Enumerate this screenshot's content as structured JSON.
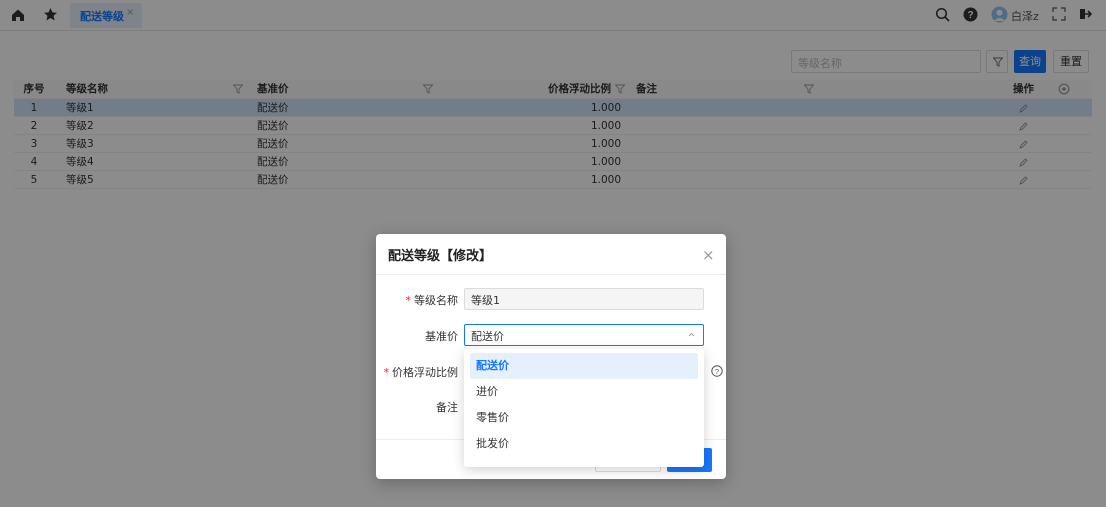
{
  "topbar": {
    "tab_label": "配送等级",
    "tab_close": "×",
    "user_name": "白泽z"
  },
  "toolbar": {
    "search_placeholder": "等级名称",
    "query_label": "查询",
    "reset_label": "重置"
  },
  "grid": {
    "headers": {
      "idx": "序号",
      "name": "等级名称",
      "base": "基准价",
      "rate": "价格浮动比例",
      "note": "备注",
      "op": "操作"
    },
    "rows": [
      {
        "idx": "1",
        "name": "等级1",
        "base": "配送价",
        "rate": "1.000",
        "note": ""
      },
      {
        "idx": "2",
        "name": "等级2",
        "base": "配送价",
        "rate": "1.000",
        "note": ""
      },
      {
        "idx": "3",
        "name": "等级3",
        "base": "配送价",
        "rate": "1.000",
        "note": ""
      },
      {
        "idx": "4",
        "name": "等级4",
        "base": "配送价",
        "rate": "1.000",
        "note": ""
      },
      {
        "idx": "5",
        "name": "等级5",
        "base": "配送价",
        "rate": "1.000",
        "note": ""
      }
    ]
  },
  "modal": {
    "title": "配送等级【修改】",
    "close": "×",
    "fields": {
      "name_label": "等级名称",
      "name_value": "等级1",
      "base_label": "基准价",
      "base_value": "配送价",
      "rate_label": "价格浮动比例",
      "note_label": "备注"
    },
    "required_mark": "*",
    "dropdown_options": [
      "配送价",
      "进价",
      "零售价",
      "批发价"
    ]
  },
  "colors": {
    "accent": "#1677ff",
    "tab_bg": "#e8f1fd",
    "selected_row": "#cfe3fa",
    "required": "#f5222d"
  }
}
